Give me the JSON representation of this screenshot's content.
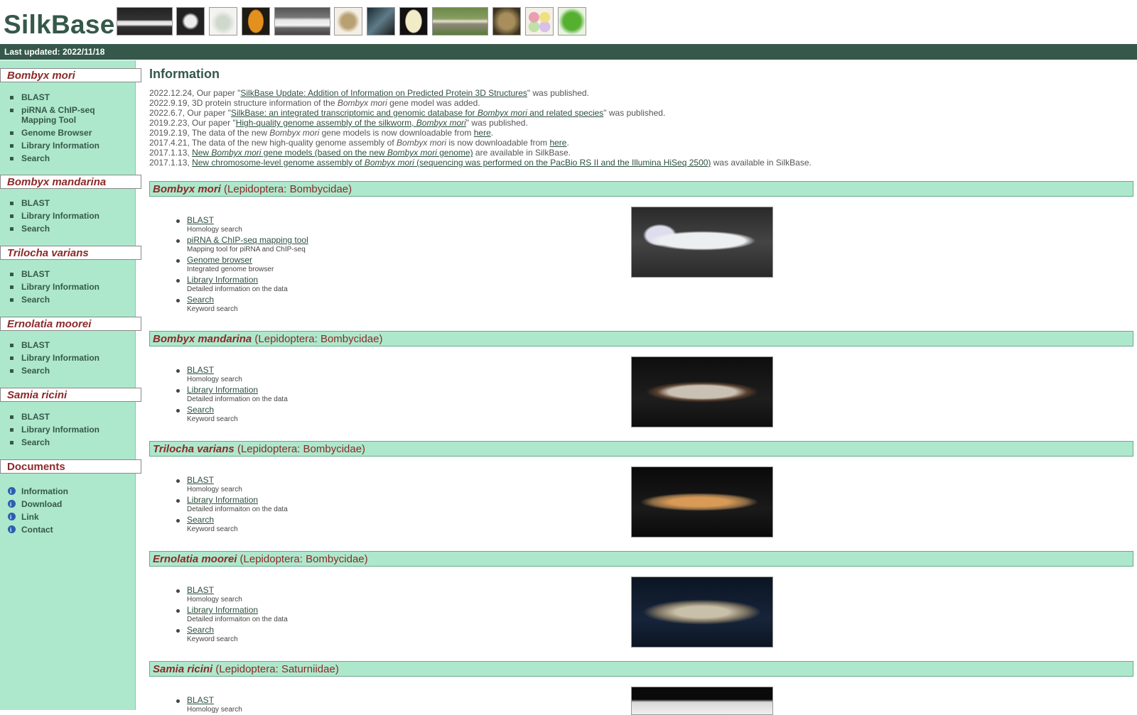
{
  "site": {
    "title": "SilkBase",
    "last_updated": "Last updated: 2022/11/18"
  },
  "thumbnails": [
    {
      "name": "larva-white-thumb"
    },
    {
      "name": "moth-silhouette-thumb"
    },
    {
      "name": "moth-pale-thumb"
    },
    {
      "name": "cocoon-orange-thumb"
    },
    {
      "name": "larva-white-2-thumb"
    },
    {
      "name": "moth-brown-thumb"
    },
    {
      "name": "hand-thumb"
    },
    {
      "name": "cocoon-cream-thumb"
    },
    {
      "name": "larva-leaf-thumb"
    },
    {
      "name": "moss-thumb"
    },
    {
      "name": "cocoons-colored-thumb"
    },
    {
      "name": "leaf-thumb"
    }
  ],
  "sidebar": {
    "groups": [
      {
        "title": "Bombyx mori",
        "items": [
          "BLAST",
          "piRNA & ChIP-seq Mapping Tool",
          "Genome Browser",
          "Library Information",
          "Search"
        ]
      },
      {
        "title": "Bombyx mandarina",
        "items": [
          "BLAST",
          "Library Information",
          "Search"
        ]
      },
      {
        "title": "Trilocha varians",
        "items": [
          "BLAST",
          "Library Information",
          "Search"
        ]
      },
      {
        "title": "Ernolatia moorei",
        "items": [
          "BLAST",
          "Library Information",
          "Search"
        ]
      },
      {
        "title": "Samia ricini",
        "items": [
          "BLAST",
          "Library Information",
          "Search"
        ]
      }
    ],
    "documents": {
      "title": "Documents",
      "items": [
        "Information",
        "Download",
        "Link",
        "Contact"
      ]
    }
  },
  "main": {
    "heading": "Information",
    "news": [
      {
        "pre": "2022.12.24, Our paper \"",
        "link": "SilkBase Update: Addition of Information on Predicted Protein 3D Structures",
        "post": "\" was published."
      },
      {
        "pre": "2022.9.19, 3D protein structure information of the ",
        "em": "Bombyx mori",
        "post": " gene model was added."
      },
      {
        "pre": "2022.6.7, Our paper \"",
        "link": "SilkBase: an integrated transcriptomic and genomic database for ",
        "linkem": "Bombyx mori",
        "link2": " and related species",
        "post": "\" was published."
      },
      {
        "pre": "2019.2.23, Our paper \"",
        "link": "High-quality genome assembly of the silkworm, ",
        "linkem": "Bombyx mori",
        "post": "\" was published."
      },
      {
        "pre": "2019.2.19, The data of the new ",
        "em": "Bombyx mori",
        "mid": " gene models is now downloadable from ",
        "link": "here",
        "post": "."
      },
      {
        "pre": "2017.4.21, The data of the new high-quality genome assembly of ",
        "em": "Bombyx mori",
        "mid": " is now downloadable from ",
        "link": "here",
        "post": "."
      },
      {
        "pre": "2017.1.13, ",
        "link": "New ",
        "linkem": "Bombyx mori",
        "link2": " gene models (based on the new ",
        "linkem2": "Bombyx mori",
        "link3": " genome)",
        "post": " are available in SilkBase."
      },
      {
        "pre": "2017.1.13, ",
        "link": "New chromosome-level genome assembly of ",
        "linkem": "Bombyx mori",
        "link2": " (sequencing was performed on the PacBio RS II and the Illumina HiSeq 2500)",
        "post": " was available in SilkBase."
      }
    ],
    "species": [
      {
        "name": "Bombyx mori",
        "family": " (Lepidoptera: Bombycidae)",
        "tools": [
          {
            "label": "BLAST",
            "desc": "Homology search"
          },
          {
            "label": "piRNA & ChIP-seq mapping tool",
            "desc": "Mapping tool for piRNA and ChIP-seq"
          },
          {
            "label": "Genome browser",
            "desc": "Integrated genome browser"
          },
          {
            "label": "Library Information",
            "desc": "Detailed information on the data"
          },
          {
            "label": "Search",
            "desc": "Keyword search"
          }
        ]
      },
      {
        "name": "Bombyx mandarina",
        "family": " (Lepidoptera: Bombycidae)",
        "tools": [
          {
            "label": "BLAST",
            "desc": "Homology search"
          },
          {
            "label": "Library Information",
            "desc": "Detailed information on the data"
          },
          {
            "label": "Search",
            "desc": "Keyword search"
          }
        ]
      },
      {
        "name": "Trilocha varians",
        "family": " (Lepidoptera: Bombycidae)",
        "tools": [
          {
            "label": "BLAST",
            "desc": "Homology search"
          },
          {
            "label": "Library Information",
            "desc": "Detailed informaiton on the data"
          },
          {
            "label": "Search",
            "desc": "Keyword search"
          }
        ]
      },
      {
        "name": "Ernolatia moorei",
        "family": " (Lepidoptera: Bombycidae)",
        "tools": [
          {
            "label": "BLAST",
            "desc": "Homology search"
          },
          {
            "label": "Library Information",
            "desc": "Detailed informaiton on the data"
          },
          {
            "label": "Search",
            "desc": "Keyword search"
          }
        ]
      },
      {
        "name": "Samia ricini",
        "family": " (Lepidoptera: Saturniidae)",
        "tools": [
          {
            "label": "BLAST",
            "desc": "Homology search"
          }
        ]
      }
    ]
  }
}
